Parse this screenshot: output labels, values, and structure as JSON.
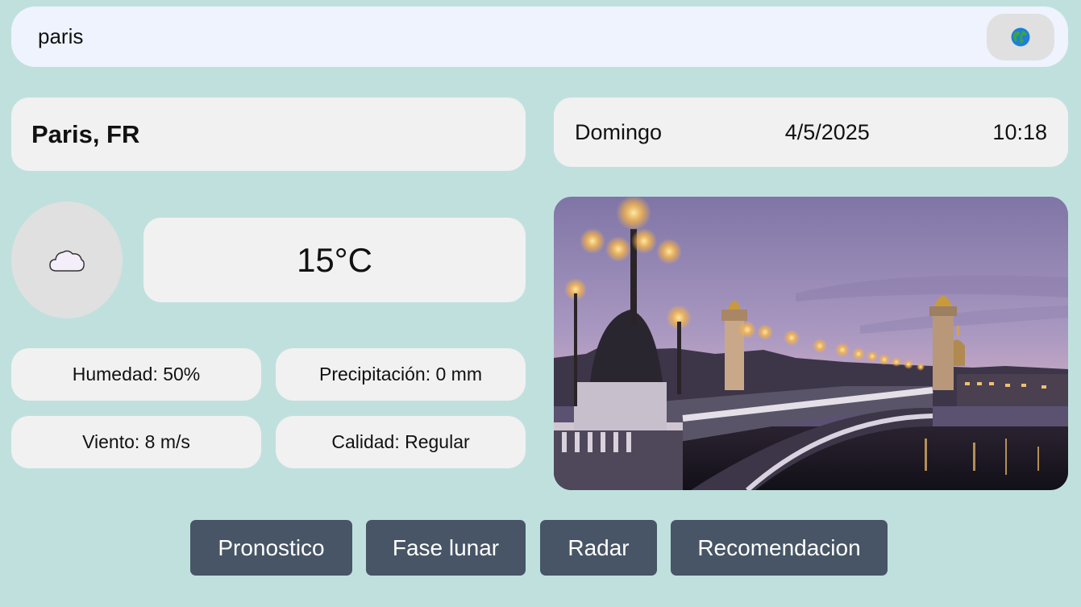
{
  "search": {
    "value": "paris"
  },
  "location": {
    "city": "Paris, FR"
  },
  "datetime": {
    "day": "Domingo",
    "date": "4/5/2025",
    "time": "10:18"
  },
  "weather": {
    "icon": "cloud-icon",
    "temperature": "15°C",
    "humidity": "Humedad: 50%",
    "precipitation": "Precipitación: 0 mm",
    "wind": "Viento: 8 m/s",
    "quality": "Calidad: Regular"
  },
  "buttons": {
    "forecast": "Pronostico",
    "moon": "Fase lunar",
    "radar": "Radar",
    "recommendation": "Recomendacion"
  },
  "colors": {
    "background": "#c0e0de",
    "card": "#f1f1f1",
    "button": "#475566"
  }
}
